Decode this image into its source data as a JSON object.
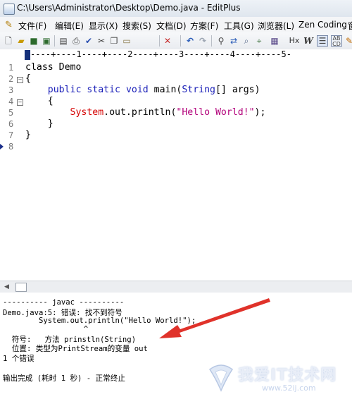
{
  "window": {
    "title": "C:\\Users\\Administrator\\Desktop\\Demo.java - EditPlus"
  },
  "menu": {
    "items": [
      {
        "label": "文件(F)"
      },
      {
        "label": "编辑(E)"
      },
      {
        "label": "显示(X)"
      },
      {
        "label": "搜索(S)"
      },
      {
        "label": "文档(D)"
      },
      {
        "label": "方案(F)"
      },
      {
        "label": "工具(G)"
      },
      {
        "label": "浏览器(L)"
      },
      {
        "label": "Zen Coding"
      },
      {
        "label": "窗"
      }
    ]
  },
  "toolbar": {
    "icons": [
      "new-file-icon",
      "open-folder-icon",
      "save-icon",
      "save-all-icon",
      "print-preview-icon",
      "print-icon",
      "spell-check-icon",
      "cut-icon",
      "copy-icon",
      "paste-icon",
      "delete-icon",
      "undo-icon",
      "redo-icon",
      "find-icon",
      "replace-icon",
      "find-in-files-icon",
      "go-to-icon",
      "html-toolbar-icon",
      "hex-icon",
      "word-wrap-icon",
      "indent-icon",
      "abc-icon",
      "edit-icon"
    ],
    "hx_label": "Hx",
    "w_label": "W"
  },
  "ruler": {
    "text": "----+----1----+----2----+----3----+----4----+----5-"
  },
  "editor": {
    "line_numbers": [
      "1",
      "2",
      "3",
      "4",
      "5",
      "6",
      "7",
      "8"
    ],
    "lines": [
      {
        "p1": "class",
        "p2": " Demo"
      },
      {
        "p1": "{"
      },
      {
        "p1": "    ",
        "p2": "public",
        "p3": " ",
        "p4": "static",
        "p5": " ",
        "p6": "void",
        "p7": " main(",
        "p8": "String",
        "p9": "[] args)"
      },
      {
        "p1": "    {"
      },
      {
        "p1": "        ",
        "p2": "System",
        "p3": ".out.println(",
        "p4": "\"Hello World!\"",
        "p5": ");"
      },
      {
        "p1": "    }"
      },
      {
        "p1": "}"
      }
    ]
  },
  "output": {
    "lines": [
      "---------- javac ----------",
      "Demo.java:5: 错误: 找不到符号",
      "        System.out.println(\"Hello World!\");",
      "                  ^",
      "  符号:   方法 prinstln(String)",
      "  位置: 类型为PrintStream的变量 out",
      "1 个错误",
      "",
      "输出完成 (耗时 1 秒) - 正常终止"
    ]
  },
  "watermark": {
    "name": "我爱IT技术网",
    "url": "www.52ij.com"
  },
  "colors": {
    "keyword": "#1a1fb8",
    "class": "#d50000",
    "string": "#b2007a",
    "arrow": "#e0322a"
  }
}
